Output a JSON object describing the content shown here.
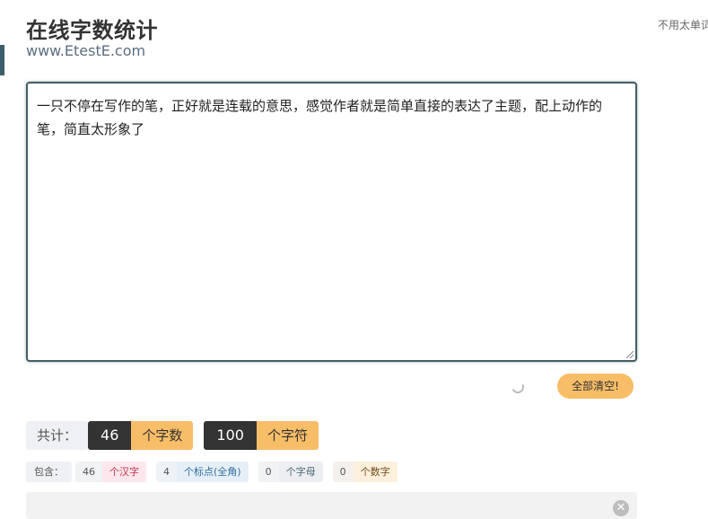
{
  "header": {
    "title": "在线字数统计",
    "subtitle": "www.EtestE.com",
    "right_note": "不用太单词"
  },
  "editor": {
    "text": "一只不停在写作的笔，正好就是连载的意思，感觉作者就是简单直接的表达了主题，配上动作的笔，简直太形象了"
  },
  "actions": {
    "clear_label": "全部清空!"
  },
  "summary": {
    "label": "共计：",
    "chars_count": "46",
    "chars_unit": "个字数",
    "symbols_count": "100",
    "symbols_unit": "个字符"
  },
  "breakdown": {
    "label": "包含：",
    "items": [
      {
        "count": "46",
        "unit": "个汉字"
      },
      {
        "count": "4",
        "unit": "个标点(全角)"
      },
      {
        "count": "0",
        "unit": "个字母"
      },
      {
        "count": "0",
        "unit": "个数字"
      }
    ]
  },
  "colors": {
    "accent": "#f7bd67",
    "dark": "#333333",
    "border": "#445e66"
  },
  "icons": {
    "loading": "spinner-icon",
    "close": "close-icon"
  }
}
